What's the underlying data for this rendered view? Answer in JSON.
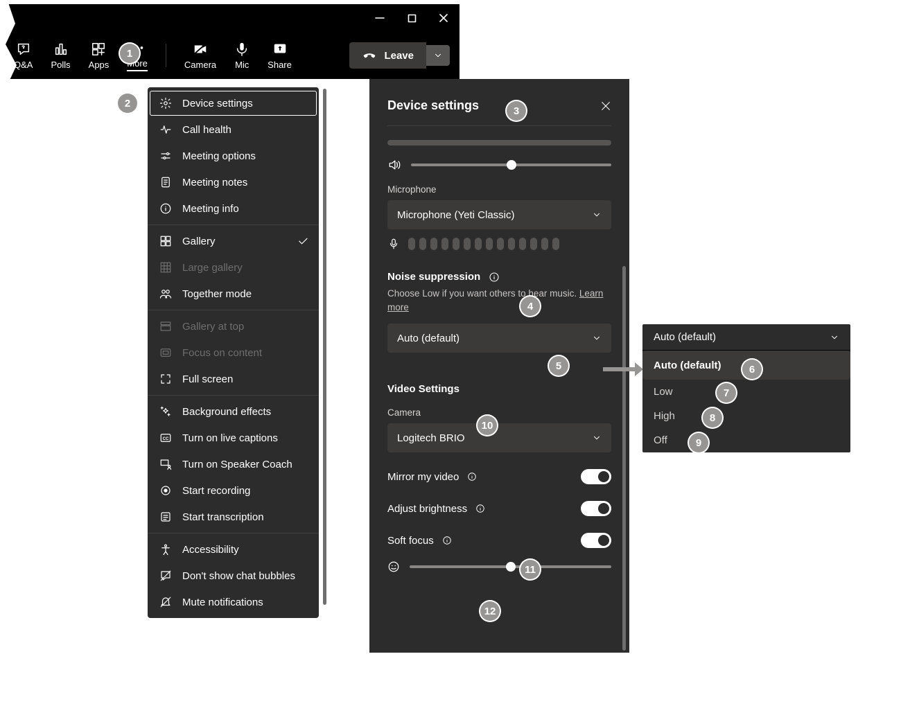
{
  "toolbar": {
    "qa": "Q&A",
    "polls": "Polls",
    "apps": "Apps",
    "more": "More",
    "camera": "Camera",
    "mic": "Mic",
    "share": "Share",
    "leave": "Leave"
  },
  "menu": {
    "device_settings": "Device settings",
    "call_health": "Call health",
    "meeting_options": "Meeting options",
    "meeting_notes": "Meeting notes",
    "meeting_info": "Meeting info",
    "gallery": "Gallery",
    "large_gallery": "Large gallery",
    "together": "Together mode",
    "gallery_top": "Gallery at top",
    "focus_content": "Focus on content",
    "full_screen": "Full screen",
    "bg_effects": "Background effects",
    "live_captions": "Turn on live captions",
    "speaker_coach": "Turn on Speaker Coach",
    "start_recording": "Start recording",
    "start_transcription": "Start transcription",
    "accessibility": "Accessibility",
    "chat_bubbles": "Don't show chat bubbles",
    "mute_notifications": "Mute notifications"
  },
  "panel": {
    "title": "Device settings",
    "microphone_label": "Microphone",
    "microphone_value": "Microphone (Yeti Classic)",
    "noise_title": "Noise suppression",
    "noise_hint": "Choose Low if you want others to hear music. ",
    "noise_learn": "Learn more",
    "noise_value": "Auto (default)",
    "video_title": "Video Settings",
    "camera_label": "Camera",
    "camera_value": "Logitech BRIO",
    "mirror": "Mirror my video",
    "brightness": "Adjust brightness",
    "soft_focus": "Soft focus"
  },
  "dropdown": {
    "current": "Auto (default)",
    "opt_auto": "Auto (default)",
    "opt_low": "Low",
    "opt_high": "High",
    "opt_off": "Off"
  },
  "badges": {
    "b1": "1",
    "b2": "2",
    "b3": "3",
    "b4": "4",
    "b5": "5",
    "b6": "6",
    "b7": "7",
    "b8": "8",
    "b9": "9",
    "b10": "10",
    "b11": "11",
    "b12": "12"
  }
}
